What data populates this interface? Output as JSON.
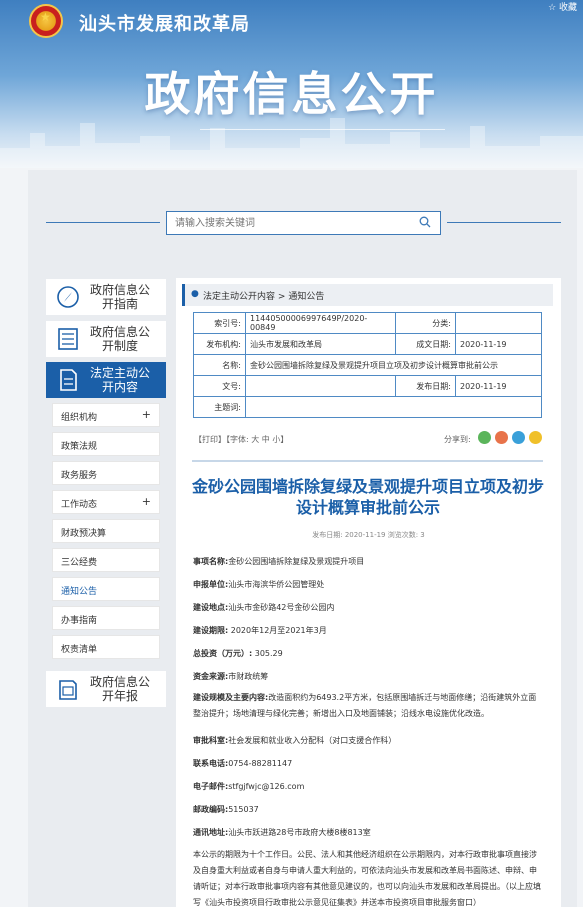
{
  "header": {
    "favorite": "☆ 收藏",
    "org_name": "汕头市发展和改革局",
    "big_title": "政府信息公开"
  },
  "search": {
    "placeholder": "请输入搜索关键词"
  },
  "sidebar": {
    "guide": "政府信息公开指南",
    "system": "政府信息公开制度",
    "content": "法定主动公开内容",
    "annual": "政府信息公开年报",
    "items": [
      {
        "label": "组织机构",
        "expand": "+"
      },
      {
        "label": "政策法规",
        "expand": ""
      },
      {
        "label": "政务服务",
        "expand": ""
      },
      {
        "label": "工作动态",
        "expand": "+"
      },
      {
        "label": "财政预决算",
        "expand": ""
      },
      {
        "label": "三公经费",
        "expand": ""
      },
      {
        "label": "通知公告",
        "expand": ""
      },
      {
        "label": "办事指南",
        "expand": ""
      },
      {
        "label": "权责清单",
        "expand": ""
      }
    ]
  },
  "breadcrumb": {
    "level1": "法定主动公开内容",
    "sep": ">",
    "level2": "通知公告"
  },
  "meta": {
    "index_label": "索引号:",
    "index_value": "11440500006997649P/2020-00849",
    "category_label": "分类:",
    "category_value": "",
    "publisher_label": "发布机构:",
    "publisher_value": "汕头市发展和改革局",
    "created_label": "成文日期:",
    "created_value": "2020-11-19",
    "name_label": "名称:",
    "name_value": "金砂公园围墙拆除复绿及景观提升项目立项及初步设计概算审批前公示",
    "docno_label": "文号:",
    "docno_value": "",
    "pubdate_label": "发布日期:",
    "pubdate_value": "2020-11-19",
    "subject_label": "主题词:",
    "subject_value": ""
  },
  "tools": {
    "print_font": "【打印】【字体: 大 中 小】",
    "share": "分享到:"
  },
  "article": {
    "title": "金砂公园围墙拆除复绿及景观提升项目立项及初步设计概算审批前公示",
    "pubinfo": "发布日期: 2020-11-19  浏览次数: 3",
    "fields": [
      {
        "k": "事项名称:",
        "v": "金砂公园围墙拆除复绿及景观提升项目"
      },
      {
        "k": "申报单位:",
        "v": "汕头市海滨华侨公园管理处"
      },
      {
        "k": "建设地点:",
        "v": "汕头市金砂路42号金砂公园内"
      },
      {
        "k": "建设期限:",
        "v": " 2020年12月至2021年3月"
      },
      {
        "k": "总投资（万元）:",
        "v": " 305.29"
      },
      {
        "k": "资金来源:",
        "v": "市财政统筹"
      }
    ],
    "scale_k": "建设规模及主要内容:",
    "scale_v": "改造面积约为6493.2平方米，包括原围墙拆迁与地面修缮；沿街建筑外立面整治提升；场地清理与绿化完善；新增出入口及地面铺装；沿线水电设施优化改造。",
    "fields2": [
      {
        "k": "审批科室:",
        "v": "社会发展和就业收入分配科（对口支援合作科）"
      },
      {
        "k": "联系电话:",
        "v": "0754-88281147"
      },
      {
        "k": "电子邮件:",
        "v": "stfgjfwjc@126.com"
      },
      {
        "k": "邮政编码:",
        "v": "515037"
      },
      {
        "k": "通讯地址:",
        "v": "汕头市跃进路28号市政府大楼8楼813室"
      }
    ],
    "notice": "本公示的期限为十个工作日。公民、法人和其他经济组织在公示期限内，对本行政审批事项直接涉及自身重大利益或者自身与申请人重大利益的，可依法向汕头市发展和改革局书面陈述、申辩、申请听证；对本行政审批事项内容有其他意见建议的，也可以向汕头市发展和改革局提出。（以上应填写《汕头市投资项目行政审批公示意见征集表》并送本市投资项目审批服务窗口）"
  }
}
